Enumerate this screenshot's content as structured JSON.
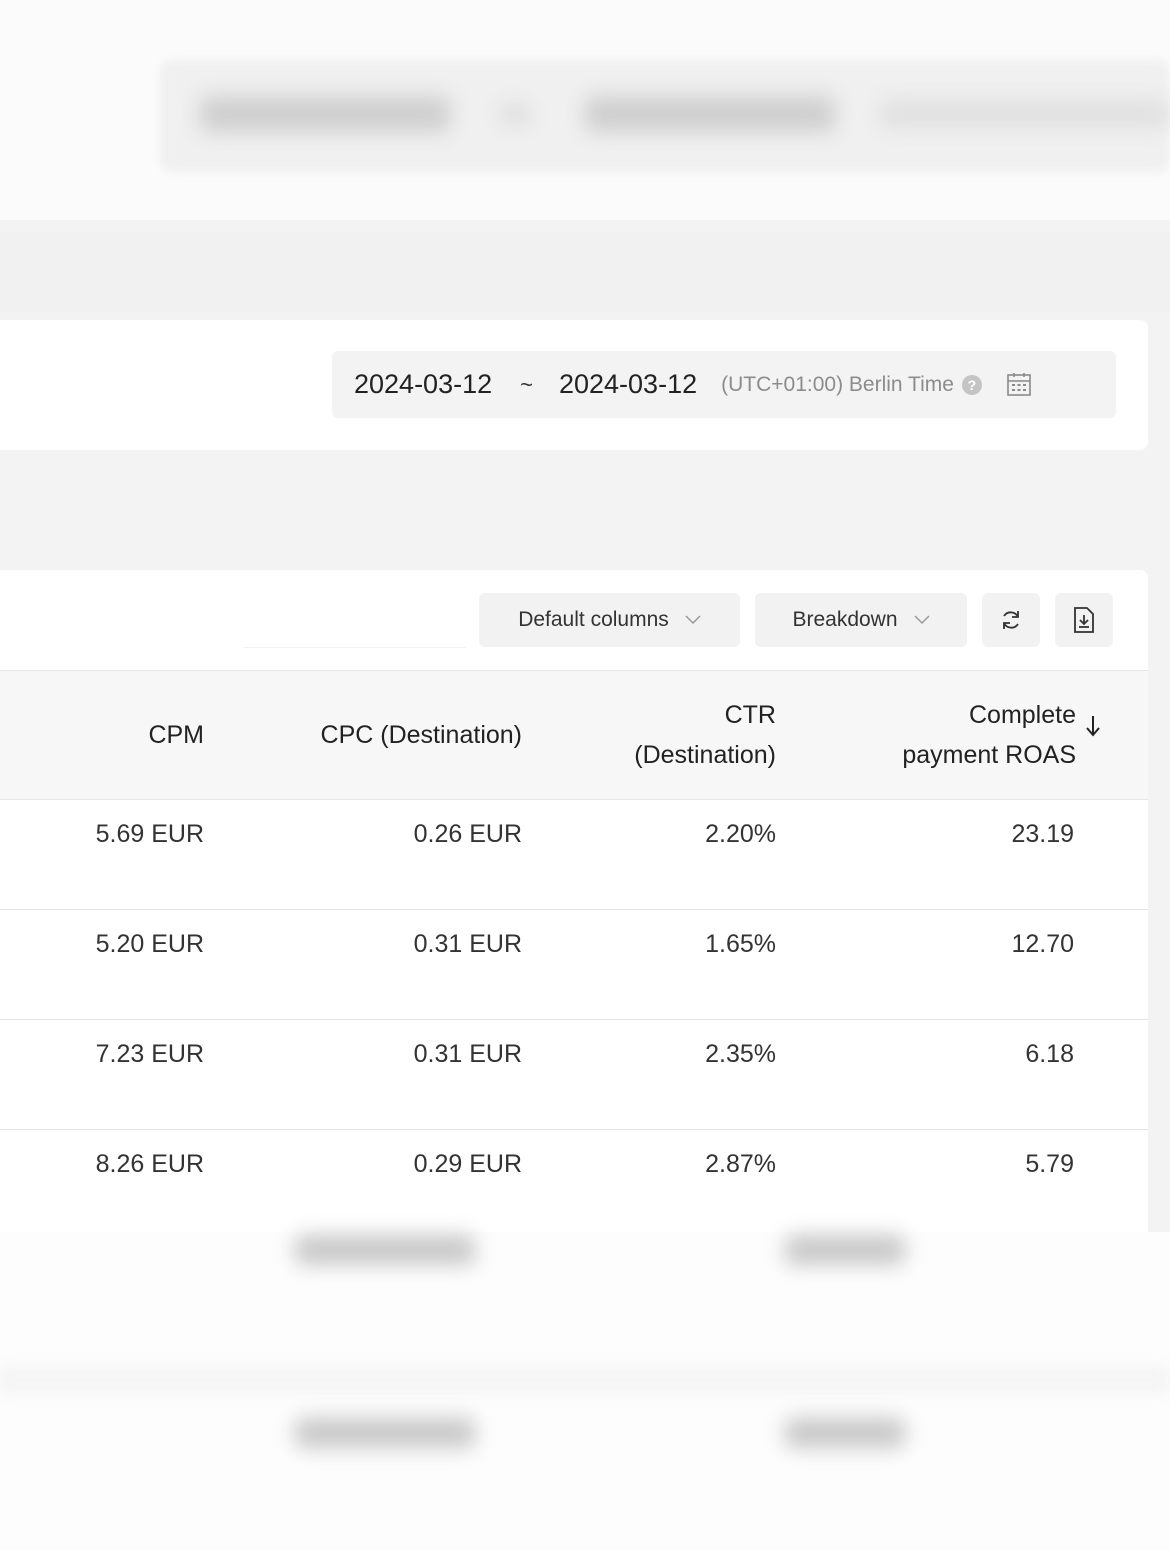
{
  "date_range": {
    "start": "2024-03-12",
    "separator": "~",
    "end": "2024-03-12",
    "timezone": "(UTC+01:00) Berlin Time",
    "help_glyph": "?",
    "icons": {
      "help": "question-circle-icon",
      "calendar": "calendar-icon"
    }
  },
  "toolbar": {
    "default_columns_label": "Default columns",
    "breakdown_label": "Breakdown",
    "icons": {
      "refresh": "refresh-icon",
      "export": "download-file-icon",
      "dropdown": "chevron-down-icon"
    }
  },
  "table": {
    "columns": [
      {
        "key": "cpm",
        "label": "CPM"
      },
      {
        "key": "cpc",
        "label": "CPC (Destination)"
      },
      {
        "key": "ctr",
        "label": "CTR\n(Destination)"
      },
      {
        "key": "roas",
        "label": "Complete\npayment ROAS",
        "sorted": "descending"
      }
    ],
    "rows": [
      {
        "cpm": "5.69 EUR",
        "cpc": "0.26 EUR",
        "ctr": "2.20%",
        "roas": "23.19"
      },
      {
        "cpm": "5.20 EUR",
        "cpc": "0.31 EUR",
        "ctr": "1.65%",
        "roas": "12.70"
      },
      {
        "cpm": "7.23 EUR",
        "cpc": "0.31 EUR",
        "ctr": "2.35%",
        "roas": "6.18"
      },
      {
        "cpm": "8.26 EUR",
        "cpc": "0.29 EUR",
        "ctr": "2.87%",
        "roas": "5.79"
      }
    ]
  },
  "colors": {
    "page_bg": "#f3f3f3",
    "panel_bg": "#ffffff",
    "header_bg": "#f7f7f7",
    "button_bg": "#f2f2f2",
    "muted_text": "#8c8c8c"
  }
}
